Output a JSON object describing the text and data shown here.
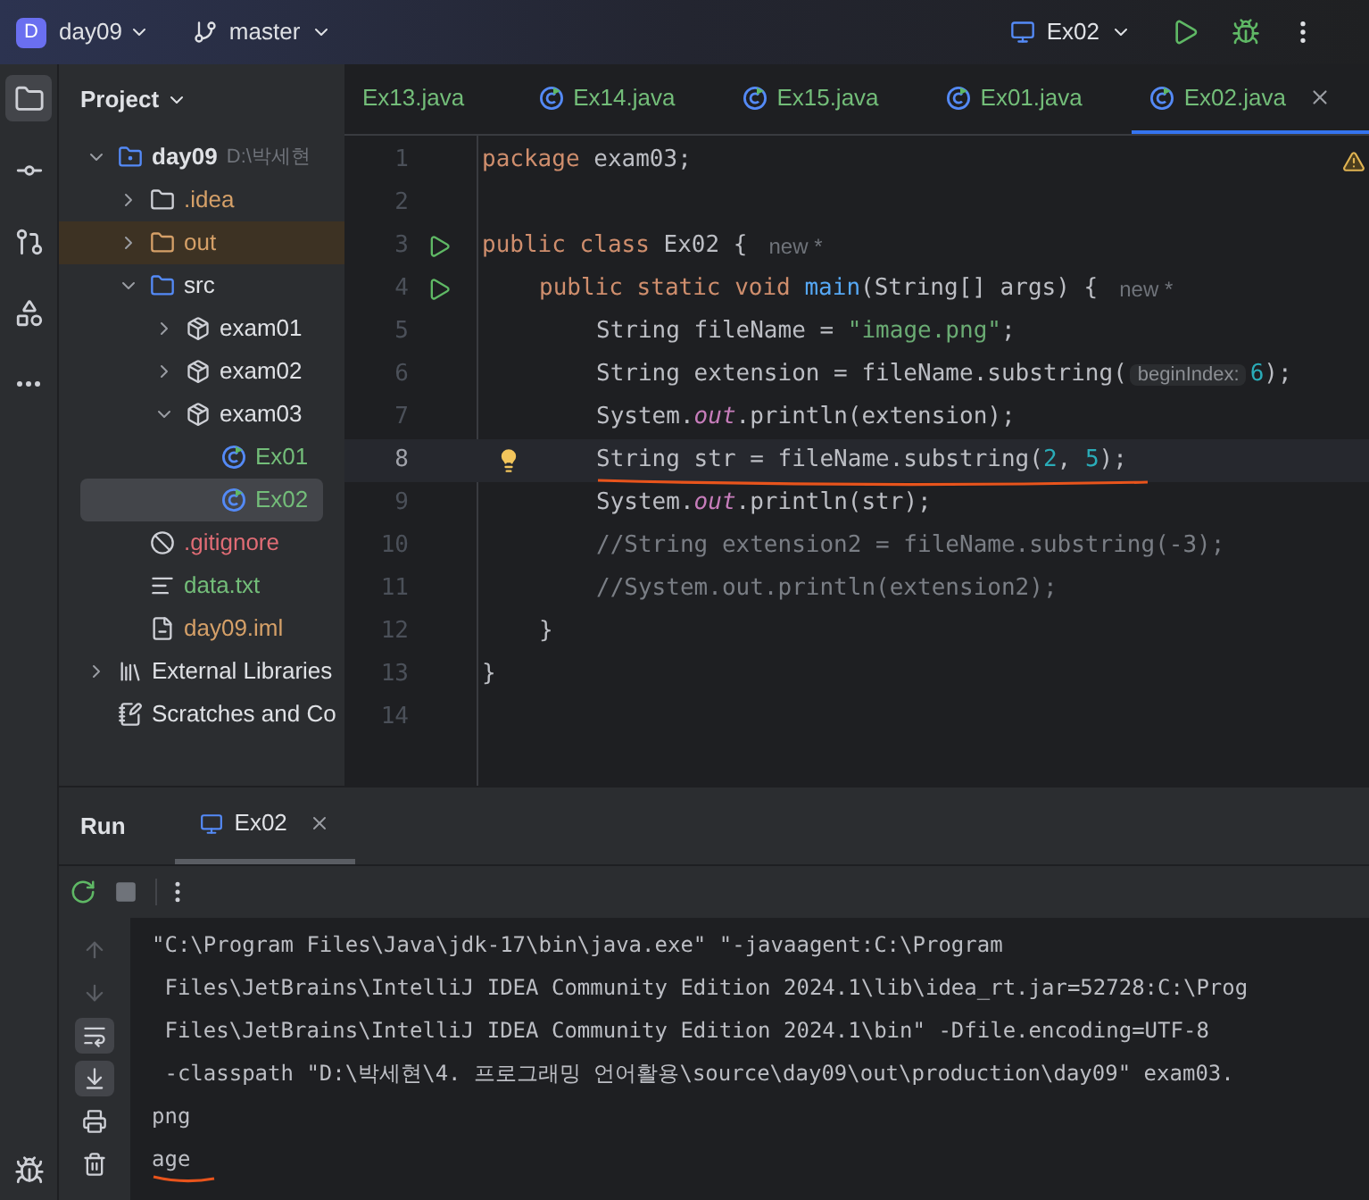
{
  "top_bar": {
    "project_badge": "D",
    "project": "day09",
    "branch": "master",
    "run_config": "Ex02"
  },
  "tool_strip": [
    {
      "kind": "project",
      "selected": true
    },
    {
      "kind": "commit",
      "selected": false
    },
    {
      "kind": "pull-requests",
      "selected": false
    },
    {
      "kind": "structure",
      "selected": false
    },
    {
      "kind": "more",
      "selected": false
    }
  ],
  "project_panel": {
    "title": "Project",
    "tree": [
      {
        "kind": "module",
        "label": "day09",
        "path": "D:\\박세현",
        "expanded": true,
        "selected": false,
        "color": "#dfe1e5",
        "children": [
          {
            "kind": "folder",
            "label": ".idea",
            "expanded": false,
            "selected": false,
            "color": "#d5a068"
          },
          {
            "kind": "excluded",
            "label": "out",
            "expanded": false,
            "selected": false,
            "color": "#d5a068"
          },
          {
            "kind": "source",
            "label": "src",
            "expanded": true,
            "selected": false,
            "color": "#dfe1e5",
            "children": [
              {
                "kind": "package",
                "label": "exam01",
                "expanded": false,
                "selected": false,
                "color": "#dfe1e5"
              },
              {
                "kind": "package",
                "label": "exam02",
                "expanded": false,
                "selected": false,
                "color": "#dfe1e5"
              },
              {
                "kind": "package",
                "label": "exam03",
                "expanded": true,
                "selected": false,
                "color": "#dfe1e5",
                "children": [
                  {
                    "kind": "class",
                    "label": "Ex01",
                    "selected": false,
                    "color": "#73bd79"
                  },
                  {
                    "kind": "class",
                    "label": "Ex02",
                    "selected": true,
                    "color": "#73bd79"
                  }
                ]
              }
            ]
          },
          {
            "kind": "ignore",
            "label": ".gitignore",
            "selected": false,
            "color": "#e06c75"
          },
          {
            "kind": "text",
            "label": "data.txt",
            "selected": false,
            "color": "#73bd79"
          },
          {
            "kind": "iml",
            "label": "day09.iml",
            "selected": false,
            "color": "#d5a068"
          }
        ]
      },
      {
        "kind": "libraries",
        "label": "External Libraries",
        "expanded": false,
        "selected": false,
        "color": "#dfe1e5"
      },
      {
        "kind": "scratches",
        "label": "Scratches and Co",
        "selected": false,
        "color": "#dfe1e5"
      }
    ]
  },
  "editor_tabs": [
    {
      "label": "Ex13.java",
      "icon": false,
      "selected": false
    },
    {
      "label": "Ex14.java",
      "icon": true,
      "selected": false
    },
    {
      "label": "Ex15.java",
      "icon": true,
      "selected": false
    },
    {
      "label": "Ex01.java",
      "icon": true,
      "selected": false
    },
    {
      "label": "Ex02.java",
      "icon": true,
      "selected": true
    }
  ],
  "code_lines": [
    {
      "number": "1",
      "warning": true,
      "tokens": [
        {
          "kind": "kw",
          "text": "package "
        },
        {
          "kind": "plain",
          "text": "exam03;"
        }
      ]
    },
    {
      "number": "2"
    },
    {
      "number": "3",
      "run": true,
      "hint": "new *",
      "tokens": [
        {
          "kind": "kw",
          "text": "public class "
        },
        {
          "kind": "plain",
          "text": "Ex02 {"
        }
      ],
      "children": [
        {
          "number": "4",
          "run": true,
          "hint": "new *",
          "tokens": [
            {
              "kind": "kw",
              "text": "public static void "
            },
            {
              "kind": "method",
              "text": "main"
            },
            {
              "kind": "plain",
              "text": "(String[] args) {"
            }
          ],
          "children": [
            {
              "number": "5",
              "tokens": [
                {
                  "kind": "plain",
                  "text": "String fileName = "
                },
                {
                  "kind": "string",
                  "text": "\"image.png\""
                },
                {
                  "kind": "plain",
                  "text": ";"
                }
              ]
            },
            {
              "number": "6",
              "tokens": [
                {
                  "kind": "plain",
                  "text": "String extension = fileName.substring("
                },
                {
                  "kind": "inlay",
                  "text": "beginIndex:"
                },
                {
                  "kind": "number",
                  "text": "6"
                },
                {
                  "kind": "plain",
                  "text": ");"
                }
              ]
            },
            {
              "number": "7",
              "tokens": [
                {
                  "kind": "plain",
                  "text": "System."
                },
                {
                  "kind": "field",
                  "text": "out"
                },
                {
                  "kind": "plain",
                  "text": ".println(extension);"
                }
              ]
            },
            {
              "number": "8",
              "current": true,
              "bulb": true,
              "underlined": true,
              "tokens": [
                {
                  "kind": "plain",
                  "text": "String str = fileName.substring("
                },
                {
                  "kind": "number",
                  "text": "2"
                },
                {
                  "kind": "plain",
                  "text": ", "
                },
                {
                  "kind": "number",
                  "text": "5"
                },
                {
                  "kind": "plain",
                  "text": ");"
                }
              ]
            },
            {
              "number": "9",
              "tokens": [
                {
                  "kind": "plain",
                  "text": "System."
                },
                {
                  "kind": "field",
                  "text": "out"
                },
                {
                  "kind": "plain",
                  "text": ".println(str);"
                }
              ]
            },
            {
              "number": "10",
              "tokens": [
                {
                  "kind": "comment",
                  "text": "//String extension2 = fileName.substring(-3);"
                }
              ]
            },
            {
              "number": "11",
              "tokens": [
                {
                  "kind": "comment",
                  "text": "//System.out.println(extension2);"
                }
              ]
            }
          ]
        },
        {
          "number": "12",
          "tokens": [
            {
              "kind": "plain",
              "text": "}"
            }
          ]
        }
      ]
    },
    {
      "number": "13",
      "tokens": [
        {
          "kind": "plain",
          "text": "}"
        }
      ]
    },
    {
      "number": "14"
    }
  ],
  "run_panel": {
    "title": "Run",
    "tabs": [
      {
        "label": "Ex02",
        "selected": true
      }
    ],
    "toolbar": [
      {
        "kind": "rerun"
      },
      {
        "kind": "stop"
      },
      {
        "kind": "more"
      }
    ],
    "side_tools": [
      {
        "kind": "up",
        "selected": false
      },
      {
        "kind": "down",
        "selected": false
      },
      {
        "kind": "wrap",
        "selected": true
      },
      {
        "kind": "scroll-end",
        "selected": true
      },
      {
        "kind": "print",
        "selected": false
      },
      {
        "kind": "trash",
        "selected": false
      }
    ],
    "console_lines": [
      {
        "text": "\"C:\\Program Files\\Java\\jdk-17\\bin\\java.exe\" \"-javaagent:C:\\Program"
      },
      {
        "text": " Files\\JetBrains\\IntelliJ IDEA Community Edition 2024.1\\lib\\idea_rt.jar=52728:C:\\Prog"
      },
      {
        "text": " Files\\JetBrains\\IntelliJ IDEA Community Edition 2024.1\\bin\" -Dfile.encoding=UTF-8"
      },
      {
        "text": " -classpath \"D:\\박세현\\4. 프로그래밍 언어활용\\source\\day09\\out\\production\\day09\" exam03."
      },
      {
        "text": "png"
      },
      {
        "text": "age",
        "underlined": true
      }
    ]
  }
}
